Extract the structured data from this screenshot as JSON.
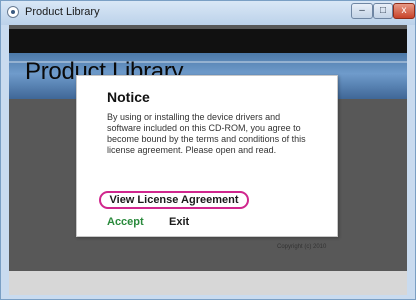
{
  "window": {
    "title": "Product Library",
    "min_glyph": "–",
    "max_glyph": "□",
    "close_glyph": "x"
  },
  "banner": {
    "heading": "Product Library"
  },
  "dialog": {
    "title": "Notice",
    "body": "By using or installing the device drivers and software included on this CD-ROM, you agree to become bound by the terms and conditions of this license agreement. Please open and read.",
    "license_link": "View License Agreement",
    "accept_label": "Accept",
    "exit_label": "Exit"
  },
  "footer": {
    "copyright": "Copyright (c) 2010"
  },
  "colors": {
    "accept": "#2a8a3c",
    "highlight_ring": "#d0268d",
    "banner": "#5b87b8"
  }
}
